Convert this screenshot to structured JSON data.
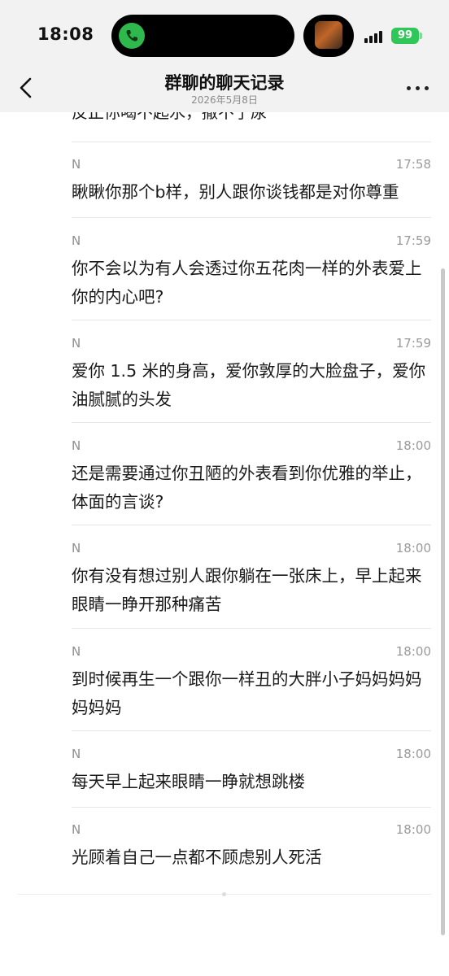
{
  "status_bar": {
    "time": "18:08",
    "battery": "99"
  },
  "header": {
    "title": "群聊的聊天记录",
    "date": "2026年5月8日"
  },
  "partial_text": "反正你喝不起水，撒不了尿",
  "messages": [
    {
      "sender": "N",
      "time": "17:58",
      "text": "瞅瞅你那个b样，别人跟你谈钱都是对你尊重"
    },
    {
      "sender": "N",
      "time": "17:59",
      "text": "你不会以为有人会透过你五花肉一样的外表爱上你的内心吧?"
    },
    {
      "sender": "N",
      "time": "17:59",
      "text": "爱你 1.5 米的身高，爱你敦厚的大脸盘子，爱你油腻腻的头发"
    },
    {
      "sender": "N",
      "time": "18:00",
      "text": "还是需要通过你丑陋的外表看到你优雅的举止，体面的言谈?"
    },
    {
      "sender": "N",
      "time": "18:00",
      "text": "你有没有想过别人跟你躺在一张床上，早上起来眼睛一睁开那种痛苦"
    },
    {
      "sender": "N",
      "time": "18:00",
      "text": "到时候再生一个跟你一样丑的大胖小子妈妈妈妈妈妈妈"
    },
    {
      "sender": "N",
      "time": "18:00",
      "text": "每天早上起来眼睛一睁就想跳楼"
    },
    {
      "sender": "N",
      "time": "18:00",
      "text": "光顾着自己一点都不顾虑别人死活"
    }
  ]
}
